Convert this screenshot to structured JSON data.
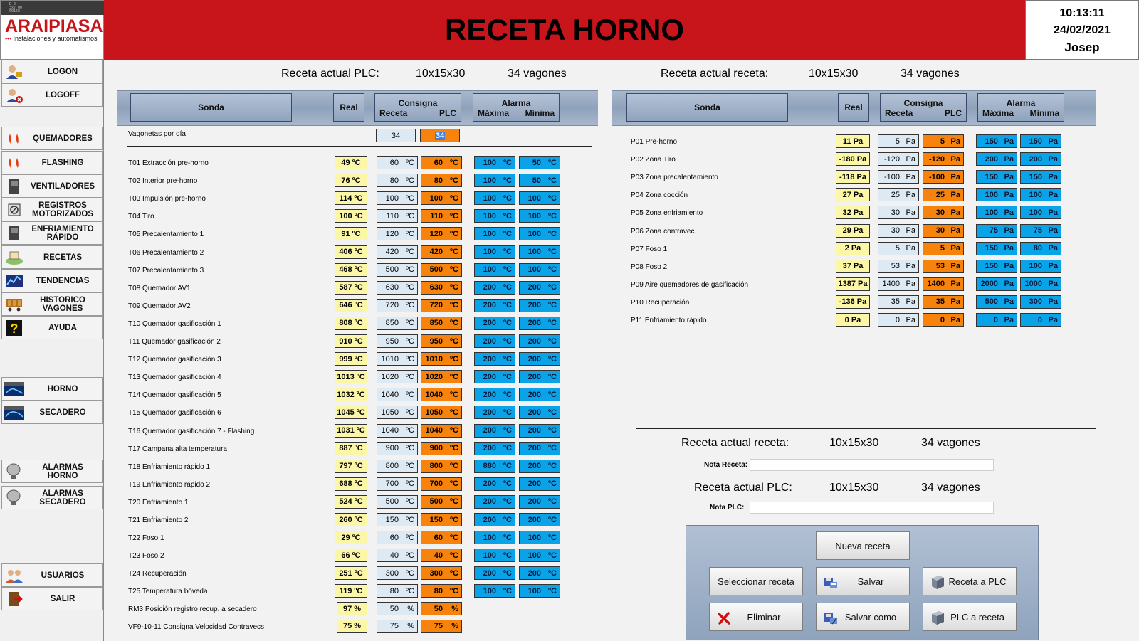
{
  "logo": {
    "name": "ARAIPIASA",
    "tagline": "Instalaciones y automatismos",
    "strip_text": "D 2\n3x7 00\n00168"
  },
  "header": {
    "title": "RECETA HORNO"
  },
  "clock": {
    "time": "10:13:11",
    "date": "24/02/2021",
    "user": "Josep"
  },
  "sidebar": {
    "items": [
      {
        "label": "LOGON",
        "icon": "logon-user-icon"
      },
      {
        "label": "LOGOFF",
        "icon": "logoff-user-icon"
      },
      {
        "label": "QUEMADORES",
        "icon": "flame-icon"
      },
      {
        "label": "FLASHING",
        "icon": "flame-icon"
      },
      {
        "label": "VENTILADORES",
        "icon": "fan-cabinet-icon"
      },
      {
        "label": "REGISTROS MOTORIZADOS",
        "icon": "damper-icon"
      },
      {
        "label": "ENFRIAMIENTO RÁPIDO",
        "icon": "cooling-cabinet-icon"
      },
      {
        "label": "RECETAS",
        "icon": "recipes-icon"
      },
      {
        "label": "TENDENCIAS",
        "icon": "trend-chart-icon"
      },
      {
        "label": "HISTORICO VAGONES",
        "icon": "wagon-history-icon"
      },
      {
        "label": "AYUDA",
        "icon": "help-icon"
      },
      {
        "label": "HORNO",
        "icon": "kiln-icon"
      },
      {
        "label": "SECADERO",
        "icon": "dryer-icon"
      },
      {
        "label": "ALARMAS HORNO",
        "icon": "alarm-bell-icon"
      },
      {
        "label": "ALARMAS SECADERO",
        "icon": "alarm-bell-icon"
      },
      {
        "label": "USUARIOS",
        "icon": "users-icon"
      },
      {
        "label": "SALIR",
        "icon": "exit-door-icon"
      }
    ]
  },
  "info": {
    "plc_label": "Receta actual PLC:",
    "plc_recipe": "10x15x30",
    "plc_wagons": "34 vagones",
    "rec_label": "Receta actual receta:",
    "rec_recipe": "10x15x30",
    "rec_wagons": "34 vagones"
  },
  "table_headers": {
    "sonda": "Sonda",
    "real": "Real",
    "consigna": "Consigna",
    "receta": "Receta",
    "plc": "PLC",
    "alarma": "Alarma",
    "maxima": "Máxima",
    "minima": "Mínima"
  },
  "vagonetas": {
    "label": "Vagonetas por día",
    "receta": "34",
    "plc": "34"
  },
  "temp_rows": [
    {
      "name": "T01 Extracción pre-horno",
      "real": "49 ºC",
      "receta": "60",
      "plc": "60",
      "max": "100",
      "min": "50",
      "unit": "ºC"
    },
    {
      "name": "T02 Interior pre-horno",
      "real": "76 ºC",
      "receta": "80",
      "plc": "80",
      "max": "100",
      "min": "50",
      "unit": "ºC"
    },
    {
      "name": "T03 Impulsión pre-horno",
      "real": "114 ºC",
      "receta": "100",
      "plc": "100",
      "max": "100",
      "min": "100",
      "unit": "ºC"
    },
    {
      "name": "T04 Tiro",
      "real": "100 ºC",
      "receta": "110",
      "plc": "110",
      "max": "100",
      "min": "100",
      "unit": "ºC"
    },
    {
      "name": "T05 Precalentamiento 1",
      "real": "91 ºC",
      "receta": "120",
      "plc": "120",
      "max": "100",
      "min": "100",
      "unit": "ºC"
    },
    {
      "name": "T06 Precalentamiento 2",
      "real": "406 ºC",
      "receta": "420",
      "plc": "420",
      "max": "100",
      "min": "100",
      "unit": "ºC"
    },
    {
      "name": "T07 Precalentamiento 3",
      "real": "468 ºC",
      "receta": "500",
      "plc": "500",
      "max": "100",
      "min": "100",
      "unit": "ºC"
    },
    {
      "name": "T08 Quemador AV1",
      "real": "587 ºC",
      "receta": "630",
      "plc": "630",
      "max": "200",
      "min": "200",
      "unit": "ºC"
    },
    {
      "name": "T09 Quemador AV2",
      "real": "646 ºC",
      "receta": "720",
      "plc": "720",
      "max": "200",
      "min": "200",
      "unit": "ºC"
    },
    {
      "name": "T10 Quemador gasificación 1",
      "real": "808 ºC",
      "receta": "850",
      "plc": "850",
      "max": "200",
      "min": "200",
      "unit": "ºC"
    },
    {
      "name": "T11 Quemador gasificación 2",
      "real": "910 ºC",
      "receta": "950",
      "plc": "950",
      "max": "200",
      "min": "200",
      "unit": "ºC"
    },
    {
      "name": "T12 Quemador gasificación 3",
      "real": "999 ºC",
      "receta": "1010",
      "plc": "1010",
      "max": "200",
      "min": "200",
      "unit": "ºC"
    },
    {
      "name": "T13 Quemador gasificación 4",
      "real": "1013 ºC",
      "receta": "1020",
      "plc": "1020",
      "max": "200",
      "min": "200",
      "unit": "ºC"
    },
    {
      "name": "T14 Quemador gasificación 5",
      "real": "1032 ºC",
      "receta": "1040",
      "plc": "1040",
      "max": "200",
      "min": "200",
      "unit": "ºC"
    },
    {
      "name": "T15 Quemador gasificación 6",
      "real": "1045 ºC",
      "receta": "1050",
      "plc": "1050",
      "max": "200",
      "min": "200",
      "unit": "ºC"
    },
    {
      "name": "T16 Quemador gasificación 7 - Flashing",
      "real": "1031 ºC",
      "receta": "1040",
      "plc": "1040",
      "max": "200",
      "min": "200",
      "unit": "ºC"
    },
    {
      "name": "T17 Campana alta temperatura",
      "real": "887 ºC",
      "receta": "900",
      "plc": "900",
      "max": "200",
      "min": "200",
      "unit": "ºC"
    },
    {
      "name": "T18 Enfriamiento rápido 1",
      "real": "797 ºC",
      "receta": "800",
      "plc": "800",
      "max": "880",
      "min": "200",
      "unit": "ºC"
    },
    {
      "name": "T19 Enfriamiento rápido 2",
      "real": "688 ºC",
      "receta": "700",
      "plc": "700",
      "max": "200",
      "min": "200",
      "unit": "ºC"
    },
    {
      "name": "T20 Enfriamiento 1",
      "real": "524 ºC",
      "receta": "500",
      "plc": "500",
      "max": "200",
      "min": "200",
      "unit": "ºC"
    },
    {
      "name": "T21 Enfriamiento 2",
      "real": "260 ºC",
      "receta": "150",
      "plc": "150",
      "max": "200",
      "min": "200",
      "unit": "ºC"
    },
    {
      "name": "T22 Foso 1",
      "real": "29 ºC",
      "receta": "60",
      "plc": "60",
      "max": "100",
      "min": "100",
      "unit": "ºC"
    },
    {
      "name": "T23 Foso 2",
      "real": "66 ºC",
      "receta": "40",
      "plc": "40",
      "max": "100",
      "min": "100",
      "unit": "ºC"
    },
    {
      "name": "T24 Recuperación",
      "real": "251 ºC",
      "receta": "300",
      "plc": "300",
      "max": "200",
      "min": "200",
      "unit": "ºC"
    },
    {
      "name": "T25 Temperatura bóveda",
      "real": "119 ºC",
      "receta": "80",
      "plc": "80",
      "max": "100",
      "min": "100",
      "unit": "ºC"
    }
  ],
  "pct_rows": [
    {
      "name": "RM3 Posición registro recup. a secadero",
      "real": "97 %",
      "receta": "50",
      "plc": "50",
      "unit": "%"
    },
    {
      "name": "VF9-10-11 Consigna Velocidad Contravecs",
      "real": "75 %",
      "receta": "75",
      "plc": "75",
      "unit": "%"
    }
  ],
  "pressure_rows": [
    {
      "name": "P01 Pre-horno",
      "real": "11 Pa",
      "receta": "5",
      "plc": "5",
      "max": "150",
      "min": "150",
      "unit": "Pa"
    },
    {
      "name": "P02 Zona Tiro",
      "real": "-180 Pa",
      "receta": "-120",
      "plc": "-120",
      "max": "200",
      "min": "200",
      "unit": "Pa"
    },
    {
      "name": "P03 Zona precalentamiento",
      "real": "-118 Pa",
      "receta": "-100",
      "plc": "-100",
      "max": "150",
      "min": "150",
      "unit": "Pa"
    },
    {
      "name": "P04 Zona cocción",
      "real": "27 Pa",
      "receta": "25",
      "plc": "25",
      "max": "100",
      "min": "100",
      "unit": "Pa"
    },
    {
      "name": "P05 Zona enfriamiento",
      "real": "32 Pa",
      "receta": "30",
      "plc": "30",
      "max": "100",
      "min": "100",
      "unit": "Pa"
    },
    {
      "name": "P06 Zona contravec",
      "real": "29 Pa",
      "receta": "30",
      "plc": "30",
      "max": "75",
      "min": "75",
      "unit": "Pa"
    },
    {
      "name": "P07 Foso 1",
      "real": "2 Pa",
      "receta": "5",
      "plc": "5",
      "max": "150",
      "min": "80",
      "unit": "Pa"
    },
    {
      "name": "P08 Foso 2",
      "real": "37 Pa",
      "receta": "53",
      "plc": "53",
      "max": "150",
      "min": "100",
      "unit": "Pa"
    },
    {
      "name": "P09 Aire quemadores de gasificación",
      "real": "1387 Pa",
      "receta": "1400",
      "plc": "1400",
      "max": "2000",
      "min": "1000",
      "unit": "Pa"
    },
    {
      "name": "P10 Recuperación",
      "real": "-136 Pa",
      "receta": "35",
      "plc": "35",
      "max": "500",
      "min": "300",
      "unit": "Pa"
    },
    {
      "name": "P11 Enfriamiento rápido",
      "real": "0 Pa",
      "receta": "0",
      "plc": "0",
      "max": "0",
      "min": "0",
      "unit": "Pa"
    }
  ],
  "bottom": {
    "rec_label": "Receta actual receta:",
    "rec_recipe": "10x15x30",
    "rec_wagons": "34 vagones",
    "nota_receta_label": "Nota Receta:",
    "nota_receta_value": "",
    "plc_label": "Receta actual PLC:",
    "plc_recipe": "10x15x30",
    "plc_wagons": "34 vagones",
    "nota_plc_label": "Nota PLC:",
    "nota_plc_value": ""
  },
  "buttons": {
    "nueva": "Nueva receta",
    "seleccionar": "Seleccionar receta",
    "salvar": "Salvar",
    "receta_a_plc": "Receta a PLC",
    "eliminar": "Eliminar",
    "salvar_como": "Salvar como",
    "plc_a_receta": "PLC a receta"
  },
  "colors": {
    "header_red": "#c8141b",
    "real_yellow": "#fbf7a6",
    "receta_blue": "#dde9f3",
    "plc_orange": "#f7830d",
    "alarm_blue": "#0aa3e8"
  }
}
